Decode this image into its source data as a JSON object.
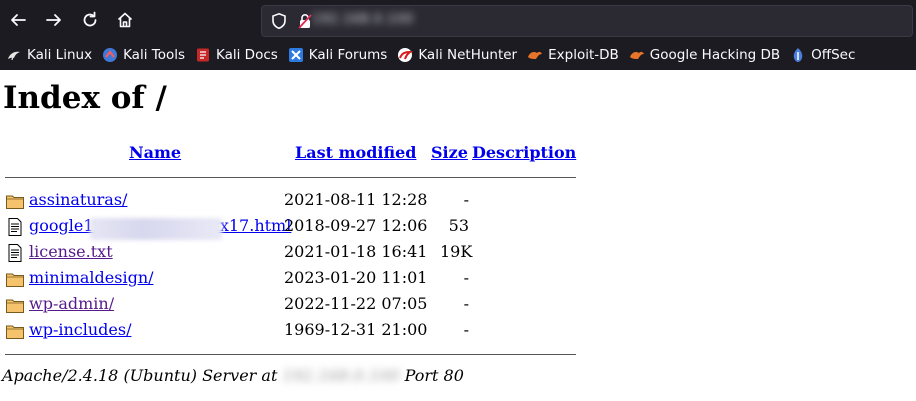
{
  "browser": {
    "url": "192.168.0.100",
    "bookmarks": [
      {
        "label": "Kali Linux",
        "icon": "kali-dragon-icon"
      },
      {
        "label": "Kali Tools",
        "icon": "kali-tools-icon"
      },
      {
        "label": "Kali Docs",
        "icon": "kali-docs-icon"
      },
      {
        "label": "Kali Forums",
        "icon": "kali-forums-icon"
      },
      {
        "label": "Kali NetHunter",
        "icon": "kali-nethunter-icon"
      },
      {
        "label": "Exploit-DB",
        "icon": "exploit-db-icon"
      },
      {
        "label": "Google Hacking DB",
        "icon": "ghdb-icon"
      },
      {
        "label": "OffSec",
        "icon": "offsec-icon"
      }
    ]
  },
  "page": {
    "title": "Index of /",
    "columns": {
      "name": "Name",
      "last_modified": "Last modified",
      "size": "Size",
      "description": "Description"
    },
    "rows": [
      {
        "name": "assinaturas/",
        "type": "folder",
        "modified": "2021-08-11 12:28",
        "size": "-",
        "visited": false
      },
      {
        "name": "google1xxxxxxxxxxxxxxx17.html",
        "type": "file",
        "modified": "2018-09-27 12:06",
        "size": "53",
        "visited": false
      },
      {
        "name": "license.txt",
        "type": "file",
        "modified": "2021-01-18 16:41",
        "size": "19K",
        "visited": true
      },
      {
        "name": "minimaldesign/",
        "type": "folder",
        "modified": "2023-01-20 11:01",
        "size": "-",
        "visited": false
      },
      {
        "name": "wp-admin/",
        "type": "folder",
        "modified": "2022-11-22 07:05",
        "size": "-",
        "visited": true
      },
      {
        "name": "wp-includes/",
        "type": "folder",
        "modified": "1969-12-31 21:00",
        "size": "-",
        "visited": false
      }
    ],
    "footer": {
      "prefix": "Apache/2.4.18 (Ubuntu) Server at ",
      "host": "192.168.0.100",
      "suffix": " Port 80"
    }
  },
  "colors": {
    "chrome_bg": "#1c1b22",
    "link": "#0000ee",
    "visited_link": "#551a8b"
  }
}
